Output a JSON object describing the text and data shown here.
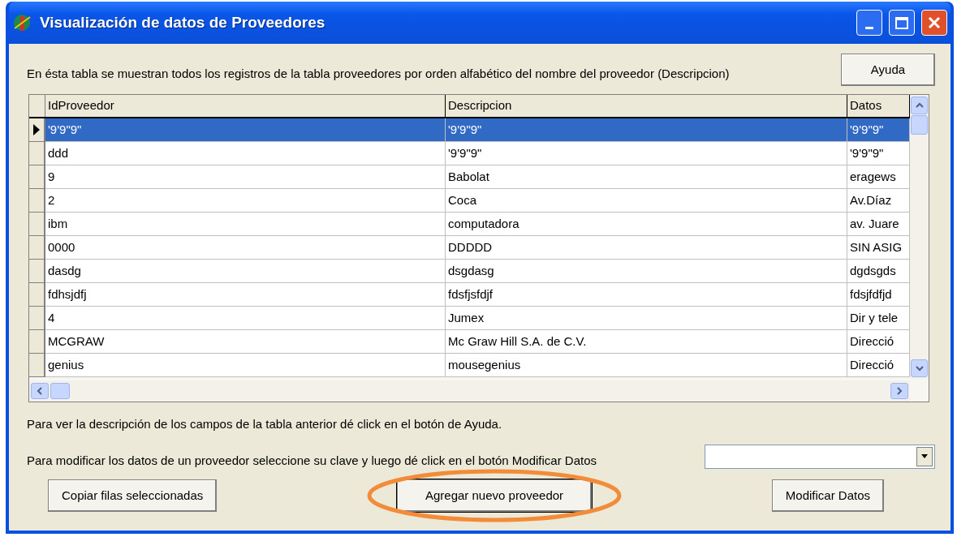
{
  "window": {
    "title": "Visualización de datos de Proveedores"
  },
  "intro": "En ésta tabla se muestran todos los registros de la tabla proveedores por orden alfabético del nombre del proveedor (Descripcion)",
  "help_button": "Ayuda",
  "table": {
    "columns": [
      "IdProveedor",
      "Descripcion",
      "Datos"
    ],
    "rows": [
      {
        "cells": [
          "'9'9\"9\"",
          "'9'9\"9\"",
          "'9'9\"9\""
        ],
        "selected": true
      },
      {
        "cells": [
          "ddd",
          "'9'9\"9\"",
          "'9'9\"9\""
        ],
        "selected": false
      },
      {
        "cells": [
          "9",
          "Babolat",
          "eragews"
        ],
        "selected": false
      },
      {
        "cells": [
          "2",
          "Coca",
          "Av.Díaz"
        ],
        "selected": false
      },
      {
        "cells": [
          "ibm",
          "computadora",
          "av. Juare"
        ],
        "selected": false
      },
      {
        "cells": [
          "0000",
          "DDDDD",
          "SIN ASIG"
        ],
        "selected": false
      },
      {
        "cells": [
          "dasdg",
          "dsgdasg",
          "dgdsgds"
        ],
        "selected": false
      },
      {
        "cells": [
          "fdhsjdfj",
          "fdsfjsfdjf",
          "fdsjfdfjd"
        ],
        "selected": false
      },
      {
        "cells": [
          "4",
          "Jumex",
          "Dir y tele"
        ],
        "selected": false
      },
      {
        "cells": [
          "MCGRAW",
          "Mc Graw Hill S.A. de C.V.",
          "Direcció"
        ],
        "selected": false
      },
      {
        "cells": [
          "genius",
          "mousegenius",
          "Direcció"
        ],
        "selected": false
      }
    ]
  },
  "help_hint": "Para ver la descripción de los campos de la tabla anterior dé click en el botón de Ayuda.",
  "modify_hint": "Para modificar los datos de un proveedor seleccione su clave y luego dé click en el botón Modificar Datos",
  "buttons": [
    {
      "label": "Copiar filas seleccionadas",
      "highlighted": false
    },
    {
      "label": "Agregar nuevo proveedor",
      "highlighted": true
    },
    {
      "label": "Modificar Datos",
      "highlighted": false
    }
  ]
}
